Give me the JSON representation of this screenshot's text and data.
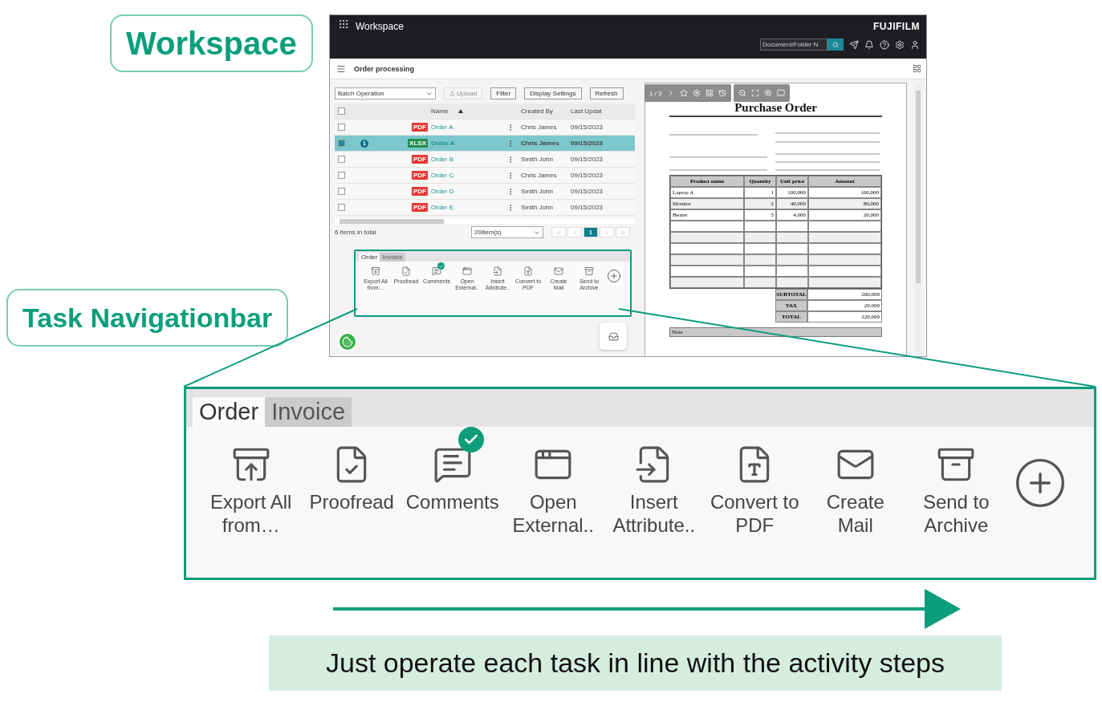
{
  "callouts": [
    {
      "text": "Workspace"
    },
    {
      "text": "Task Navigationbar"
    }
  ],
  "app": {
    "title": "Workspace",
    "brand": "FUJIFILM",
    "search_placeholder": "Document/Folder N",
    "page_title": "Order processing",
    "toolbar": {
      "batch": "Batch Operation",
      "buttons": [
        {
          "label": "Upload",
          "disabled": true
        },
        {
          "label": "Filter",
          "disabled": false
        },
        {
          "label": "Display Settings",
          "disabled": false
        },
        {
          "label": "Refresh",
          "disabled": false
        }
      ]
    },
    "table": {
      "all_selected": false,
      "columns": [
        "Name",
        "Created By",
        "Last Updat"
      ],
      "rows": [
        {
          "selected": false,
          "file_type": "PDF",
          "name": "Order A",
          "created_by": "Chris James",
          "date": "09/15/2023"
        },
        {
          "selected": true,
          "badge": "1",
          "file_type": "XLSX",
          "name": "Order A",
          "created_by": "Chris James",
          "date": "09/15/2023"
        },
        {
          "selected": false,
          "file_type": "PDF",
          "name": "Order B",
          "created_by": "Smith John",
          "date": "09/15/2023"
        },
        {
          "selected": false,
          "file_type": "PDF",
          "name": "Order C",
          "created_by": "Chris James",
          "date": "09/15/2023"
        },
        {
          "selected": false,
          "file_type": "PDF",
          "name": "Order D",
          "created_by": "Smith John",
          "date": "09/15/2023"
        },
        {
          "selected": false,
          "file_type": "PDF",
          "name": "Order E",
          "created_by": "Smith John",
          "date": "09/15/2023"
        }
      ]
    },
    "footer": {
      "total": "6 items in total",
      "per_page": "20Item(s)",
      "pages": [
        {
          "label": "1",
          "selected": true
        }
      ]
    },
    "task_navigationbar": {
      "tabs": [
        {
          "label": "Order",
          "selected": true
        },
        {
          "label": "Invoice",
          "selected": false
        }
      ],
      "tasks": [
        {
          "kind": "export",
          "label": "Export All\nfrom…",
          "checked": false
        },
        {
          "kind": "proofread",
          "label": "Proofread",
          "checked": false
        },
        {
          "kind": "comments",
          "label": "Comments",
          "checked": true
        },
        {
          "kind": "open",
          "label": "Open\nExternal..",
          "checked": false
        },
        {
          "kind": "insert",
          "label": "Insert\nAttribute..",
          "checked": false
        },
        {
          "kind": "convert",
          "label": "Convert to\nPDF",
          "checked": false
        },
        {
          "kind": "mail",
          "label": "Create\nMail",
          "checked": false
        },
        {
          "kind": "archive",
          "label": "Send to\nArchive",
          "checked": false
        }
      ]
    },
    "viewer": {
      "page": "1 / 3",
      "document": {
        "title": "Purchase Order",
        "columns": [
          "Product name",
          "Quantity",
          "Unit price",
          "Amount"
        ],
        "items": [
          [
            "Laptop A",
            "1",
            "100,000",
            "100,000"
          ],
          [
            "Monitor",
            "2",
            "40,000",
            "80,000"
          ],
          [
            "Heater",
            "5",
            "4,000",
            "20,000"
          ]
        ],
        "totals": [
          [
            "SUBTOTAL",
            "200,000"
          ],
          [
            "TAX",
            "20,000"
          ],
          [
            "TOTAL",
            "220,000"
          ]
        ],
        "note": "Note"
      }
    }
  },
  "enlarged_task_navigationbar": {
    "tabs": [
      {
        "label": "Order",
        "selected": true
      },
      {
        "label": "Invoice",
        "selected": false
      }
    ],
    "tasks": [
      {
        "kind": "export",
        "label": "Export All\nfrom…",
        "checked": false
      },
      {
        "kind": "proofread",
        "label": "Proofread",
        "checked": false
      },
      {
        "kind": "comments",
        "label": "Comments",
        "checked": true
      },
      {
        "kind": "open",
        "label": "Open\nExternal..",
        "checked": false
      },
      {
        "kind": "insert",
        "label": "Insert\nAttribute..",
        "checked": false
      },
      {
        "kind": "convert",
        "label": "Convert to\nPDF",
        "checked": false
      },
      {
        "kind": "mail",
        "label": "Create\nMail",
        "checked": false
      },
      {
        "kind": "archive",
        "label": "Send to\nArchive",
        "checked": false
      }
    ]
  },
  "caption": "Just operate each task in line with the activity steps"
}
